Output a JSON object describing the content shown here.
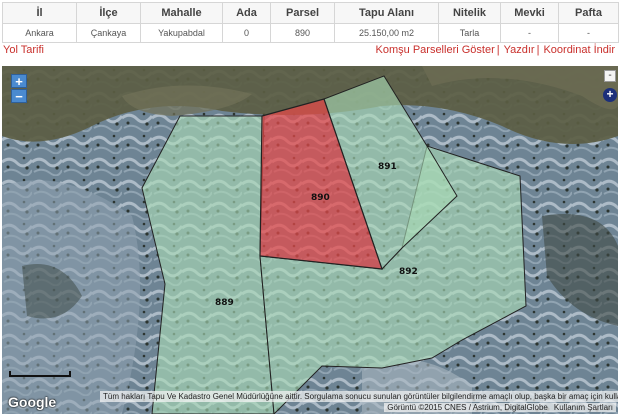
{
  "table": {
    "headers": [
      "İl",
      "İlçe",
      "Mahalle",
      "Ada",
      "Parsel",
      "Tapu Alanı",
      "Nitelik",
      "Mevki",
      "Pafta"
    ],
    "row": [
      "Ankara",
      "Çankaya",
      "Yakupabdal",
      "0",
      "890",
      "25.150,00 m2",
      "Tarla",
      "-",
      "-"
    ]
  },
  "links": {
    "route": "Yol Tarifi",
    "neighbor_parcels": "Komşu Parselleri Göster",
    "sep1": "|",
    "print": "Yazdır",
    "sep2": "|",
    "coords": "Koordinat İndir"
  },
  "map": {
    "zoom_in": "+",
    "zoom_out": "−",
    "layer_toggle": "+",
    "layer_collapse": "-",
    "google": "Google",
    "copyright": "Tüm hakları Tapu Ve Kadastro Genel Müdürlüğüne aittir. Sorgulama sonucu sunulan görüntüler bilgilendirme amaçlı olup, başka bir amaç için kullanılamaz.",
    "imagery": "Görüntü ©2015 CNES / Astrium, DigitalGlobe",
    "terms": "Kullanım Şartları",
    "parcels": [
      {
        "id": "890",
        "selected": true,
        "color": "#e64a4a"
      },
      {
        "id": "891",
        "selected": false,
        "color": "#9fd8b0"
      },
      {
        "id": "892",
        "selected": false,
        "color": "#9fd8b0"
      },
      {
        "id": "889",
        "selected": false,
        "color": "#9fd8b0"
      }
    ]
  }
}
